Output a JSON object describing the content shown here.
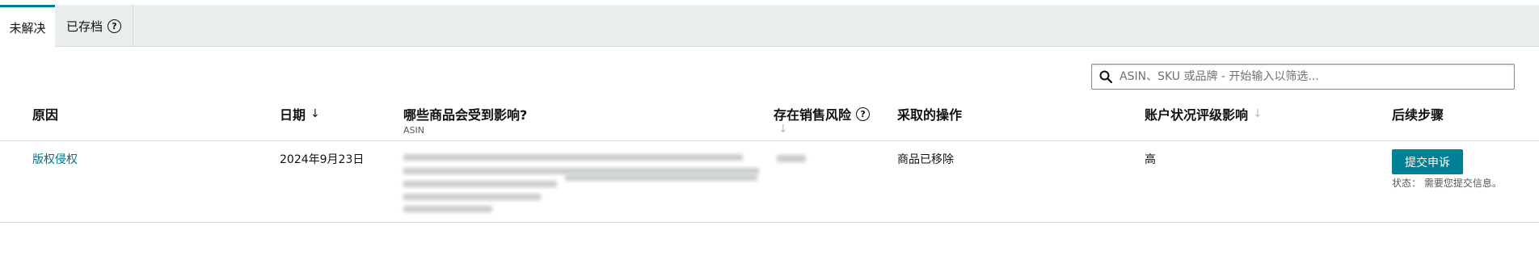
{
  "tabs": [
    {
      "label": "未解决",
      "active": true
    },
    {
      "label": "已存档",
      "help_icon": "question-circle-icon"
    }
  ],
  "search": {
    "placeholder": "ASIN、SKU 或品牌 - 开始输入以筛选..."
  },
  "table": {
    "headers": {
      "reason": "原因",
      "date": "日期",
      "affected": "哪些商品会受到影响?",
      "affected_sub": "ASIN",
      "risk": "存在销售风险",
      "action": "采取的操作",
      "account_impact": "账户状况评级影响",
      "next_steps": "后续步骤"
    },
    "rows": [
      {
        "reason": "版权侵权",
        "date": "2024年9月23日",
        "action": "商品已移除",
        "impact": "高",
        "button": "提交申诉",
        "status": "状态： 需要您提交信息。"
      }
    ]
  },
  "colors": {
    "accent": "#008296",
    "link": "#007185",
    "tab_bg": "#eaeded"
  }
}
